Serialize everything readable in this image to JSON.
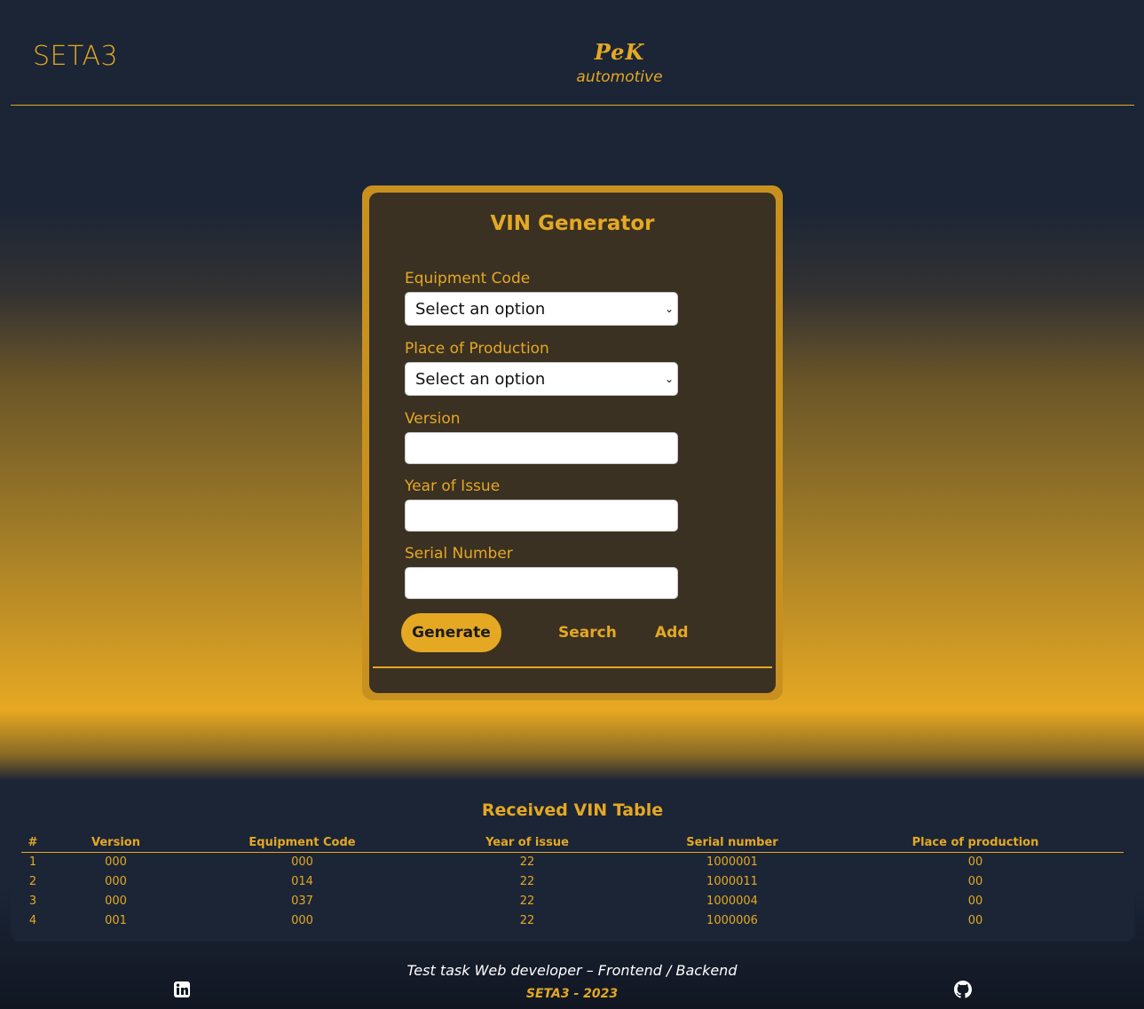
{
  "header": {
    "brand_left": "SETA3",
    "logo_mark": "PeK",
    "logo_sub": "automotive"
  },
  "form": {
    "title": "VIN Generator",
    "fields": [
      {
        "label": "Equipment Code",
        "type": "select",
        "value": "Select an option"
      },
      {
        "label": "Place of Production",
        "type": "select",
        "value": "Select an option"
      },
      {
        "label": "Version",
        "type": "input",
        "value": ""
      },
      {
        "label": "Year of Issue",
        "type": "input",
        "value": ""
      },
      {
        "label": "Serial Number",
        "type": "input",
        "value": ""
      }
    ],
    "buttons": {
      "generate": "Generate",
      "search": "Search",
      "add": "Add"
    }
  },
  "table": {
    "title": "Received VIN Table",
    "columns": [
      "#",
      "Version",
      "Equipment Code",
      "Year of issue",
      "Serial number",
      "Place of production"
    ],
    "rows": [
      [
        "1",
        "000",
        "000",
        "22",
        "1000001",
        "00"
      ],
      [
        "2",
        "000",
        "014",
        "22",
        "1000011",
        "00"
      ],
      [
        "3",
        "000",
        "037",
        "22",
        "1000004",
        "00"
      ],
      [
        "4",
        "001",
        "000",
        "22",
        "1000006",
        "00"
      ]
    ]
  },
  "footer": {
    "text": "Test task Web developer – Frontend / Backend",
    "sub": "SETA3 - 2023",
    "icons": [
      "linkedin-icon",
      "github-icon"
    ]
  },
  "colors": {
    "accent": "#e5a823",
    "panel": "#1b2536",
    "card": "#3a3123"
  }
}
